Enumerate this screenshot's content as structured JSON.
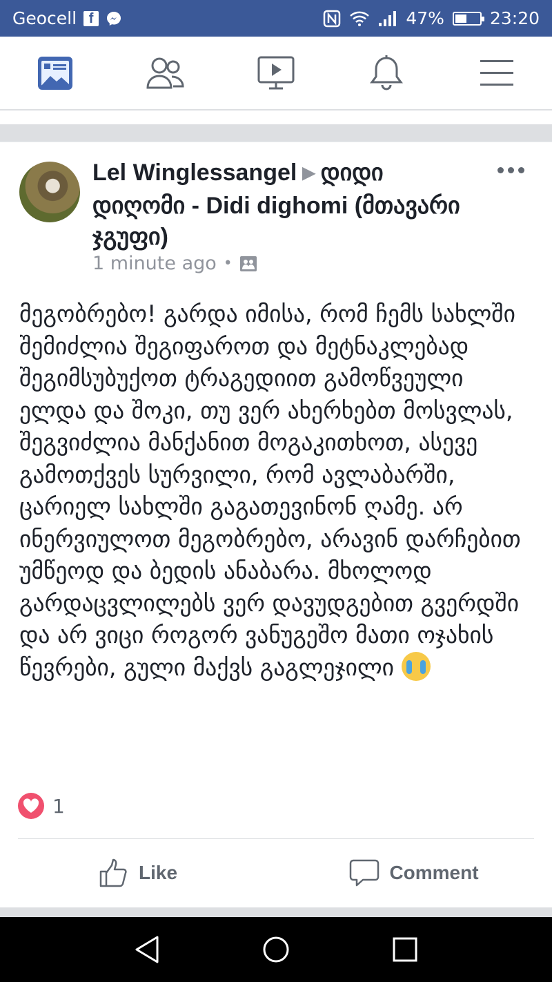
{
  "status_bar": {
    "carrier": "Geocell",
    "battery_percent": "47%",
    "battery_level": 0.47,
    "time": "23:20",
    "icons": [
      "facebook-icon",
      "messenger-icon",
      "nfc-icon",
      "wifi-icon",
      "signal-icon",
      "battery-icon"
    ]
  },
  "top_nav": {
    "tabs": [
      {
        "name": "news-feed",
        "icon": "news-feed-icon",
        "active": true
      },
      {
        "name": "friends",
        "icon": "friends-icon",
        "active": false
      },
      {
        "name": "watch",
        "icon": "video-icon",
        "active": false
      },
      {
        "name": "notifications",
        "icon": "bell-icon",
        "active": false
      },
      {
        "name": "menu",
        "icon": "hamburger-menu-icon",
        "active": false
      }
    ],
    "active_color": "#4267b2",
    "inactive_color": "#606770"
  },
  "post": {
    "author": "Lel Winglessangel",
    "arrow": "▶",
    "group": "დიდი დიღომი - Didi dighomi (მთავარი ჯგუფი)",
    "time": "1 minute ago",
    "separator": "•",
    "text": "მეგობრებო! გარდა იმისა, რომ ჩემს სახლში შემიძლია შეგიფაროთ და მეტნაკლებად შეგიმსუბუქოთ ტრაგედიით გამოწვეული ელდა და შოკი, თუ ვერ ახერხებთ მოსვლას, შეგვიძლია მანქანით მოგაკითხოთ, ასევე გამოთქვეს სურვილი, რომ ავლაბარში, ცარიელ სახლში გაგათევინონ ღამე. არ ინერვიულოთ მეგობრებო, არავინ დარჩებით უმწეოდ და ბედის ანაბარა. მხოლოდ გარდაცვლილებს ვერ დავუდგებით გვერდში და არ ვიცი როგორ ვანუგეშო მათი ოჯახის წევრები, გული მაქვს გაგლეჯილი",
    "reaction_count": "1",
    "reaction_icon": "heart-icon",
    "like_label": "Like",
    "comment_label": "Comment"
  },
  "system_nav": {
    "buttons": [
      "back-icon",
      "home-icon",
      "recents-icon"
    ]
  }
}
